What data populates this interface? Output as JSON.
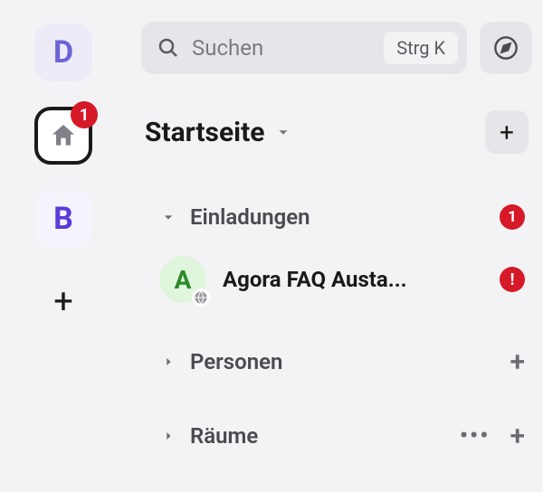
{
  "spaces": {
    "d_letter": "D",
    "home_badge": "1",
    "b_letter": "B",
    "plus": "+"
  },
  "search": {
    "placeholder": "Suchen",
    "shortcut": "Strg K"
  },
  "header": {
    "title": "Startseite"
  },
  "sections": {
    "invites": {
      "label": "Einladungen",
      "count": "1",
      "room_avatar": "A",
      "room_name": "Agora FAQ Austa...",
      "alert": "!"
    },
    "people": {
      "label": "Personen"
    },
    "rooms": {
      "label": "Räume"
    }
  }
}
